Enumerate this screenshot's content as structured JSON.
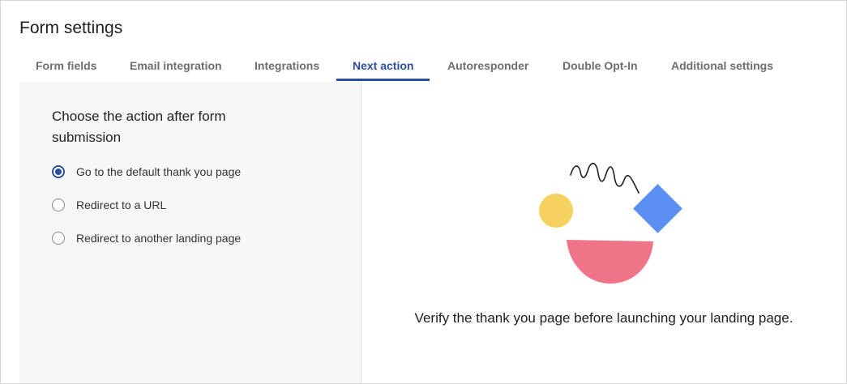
{
  "header": {
    "title": "Form settings"
  },
  "tabs": [
    {
      "label": "Form fields",
      "active": false
    },
    {
      "label": "Email integration",
      "active": false
    },
    {
      "label": "Integrations",
      "active": false
    },
    {
      "label": "Next action",
      "active": true
    },
    {
      "label": "Autoresponder",
      "active": false
    },
    {
      "label": "Double Opt-In",
      "active": false
    },
    {
      "label": "Additional settings",
      "active": false
    }
  ],
  "next_action": {
    "heading": "Choose the action after form submission",
    "options": [
      {
        "label": "Go to the default thank you page",
        "selected": true
      },
      {
        "label": "Redirect to a URL",
        "selected": false
      },
      {
        "label": "Redirect to another landing page",
        "selected": false
      }
    ]
  },
  "preview": {
    "illustration_icon": "thank-you-illustration",
    "message": "Verify the thank you page before launching your landing page."
  },
  "colors": {
    "accent": "#2a4f9a",
    "panel_background": "#f7f7f7",
    "circle_yellow": "#f5d160",
    "diamond_blue": "#5b8ff3",
    "bowl_pink": "#ef7488"
  }
}
